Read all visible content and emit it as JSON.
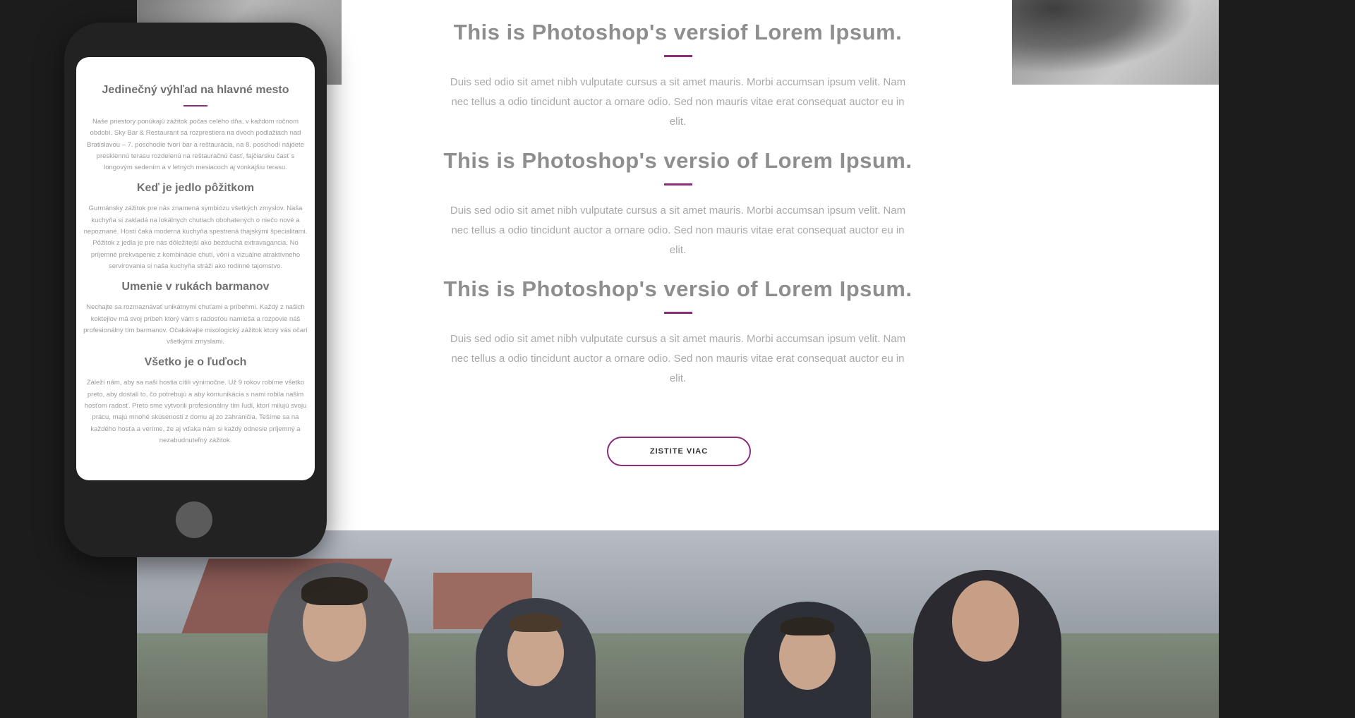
{
  "sections": [
    {
      "title": "This is Photoshop's versiof Lorem Ipsum.",
      "text": "Duis sed odio sit amet nibh vulputate cursus a sit amet mauris. Morbi accumsan ipsum velit. Nam nec tellus a odio tincidunt auctor a ornare odio. Sed non  mauris vitae erat consequat auctor eu in elit."
    },
    {
      "title": "This is Photoshop's versio of Lorem Ipsum.",
      "text": "Duis sed odio sit amet nibh vulputate cursus a sit amet mauris. Morbi accumsan ipsum velit. Nam nec tellus a odio tincidunt auctor a ornare odio. Sed non  mauris vitae erat consequat auctor eu in elit."
    },
    {
      "title": "This is Photoshop's versio of Lorem Ipsum.",
      "text": "Duis sed odio sit amet nibh vulputate cursus a sit amet mauris. Morbi accumsan ipsum velit. Nam nec tellus a odio tincidunt auctor a ornare odio. Sed non  mauris vitae erat consequat auctor eu in elit."
    }
  ],
  "cta": {
    "label": "ZISTITE VIAC"
  },
  "phone": {
    "sections": [
      {
        "title": "Jedinečný výhľad na hlavné mesto",
        "text": "Naše priestory ponúkajú zážitok počas celého dňa, v každom ročnom období. Sky Bar & Restaurant sa rozprestiera na dvoch podlažiach nad Bratislavou – 7. poschodie tvorí bar a reštaurácia, na 8. poschodí nájdete presklennú terasu rozdelenú na reštauračnú časť, fajčiarsku časť s longovým sedením a v letných mesiacoch aj vonkajšiu terasu."
      },
      {
        "title": "Keď je jedlo pôžitkom",
        "text": "Gurmánsky zážitok pre nás znamená symbiózu všetkých zmyslov. Naša kuchyňa si zakladá na lokálnych chutiach obohatených o niečo nové a nepoznané. Hostí čaká moderná kuchyňa spestrená thajskými špecialitami. Pôžitok z jedla je pre nás dôležitejší ako bezduchá extravagancia. No príjemné prekvapenie z kombinácie chutí, vôní a vizuálne atraktívneho servírovania si naša kuchyňa stráži ako rodinné tajomstvo."
      },
      {
        "title": "Umenie v rukách barmanov",
        "text": "Nechajte sa rozmaznávať unikátnymi chuťami a príbehmi. Každý z našich koktejlov má svoj príbeh ktorý vám s radosťou namieša a rozpovie náš profesionálny tím barmanov. Očakávajte mixologický zážitok ktorý vás očarí všetkými zmyslami."
      },
      {
        "title": "Všetko je o ľuďoch",
        "text": "Záleží nám, aby sa naši hostia cítili výnimočne. Už 9 rokov robíme všetko preto, aby dostali to, čo potrebujú a aby komunikácia s nami robila našim hosťom radosť. Preto sme vytvorili profesionálny tím ľudí, ktorí milujú svoju prácu, majú mnohé skúsenosti z domu aj zo zahraničia. Tešíme sa na každého hosťa a veríme, že aj vďaka nám si každý odnesie príjemný a nezabudnuteľný zážitok."
      }
    ]
  },
  "colors": {
    "accent": "#8c2d7c",
    "background": "#1c1c1c"
  }
}
